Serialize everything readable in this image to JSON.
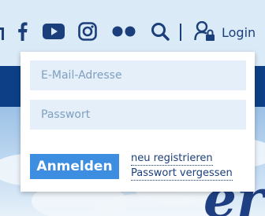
{
  "header": {
    "icons": [
      "facebook-icon",
      "youtube-icon",
      "instagram-icon",
      "flickr-icon",
      "search-icon",
      "login-user-lock-icon"
    ],
    "login_label": "Login"
  },
  "login_form": {
    "email_placeholder": "E-Mail-Adresse",
    "password_placeholder": "Passwort",
    "submit_label": "Anmelden",
    "register_link": "neu registrieren",
    "forgot_link": "Passwort vergessen"
  },
  "colors": {
    "brand_navy": "#1b3f7a",
    "nav_band": "#0d3f86",
    "button_blue": "#3d8ee0",
    "field_bg": "#e4eff9",
    "header_bg": "#dbeaf7"
  }
}
